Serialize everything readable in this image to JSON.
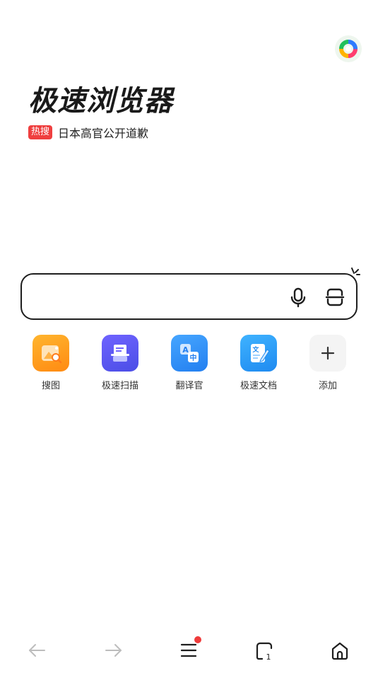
{
  "app": {
    "brand_title": "极速浏览器"
  },
  "hot_search": {
    "badge": "热搜",
    "text": "日本高官公开道歉"
  },
  "search": {
    "value": "",
    "placeholder": "",
    "mic_icon": "microphone-icon",
    "scan_icon": "scan-icon"
  },
  "shortcuts": [
    {
      "label": "搜图",
      "icon": "image-search-icon",
      "color": "#ff9a1f"
    },
    {
      "label": "极速扫描",
      "icon": "scanner-icon",
      "color": "#5b5cf0"
    },
    {
      "label": "翻译官",
      "icon": "translate-icon",
      "color": "#2f8cf5"
    },
    {
      "label": "极速文档",
      "icon": "document-icon",
      "color": "#2f9af5"
    },
    {
      "label": "添加",
      "icon": "plus-icon",
      "color": "#f4f4f4"
    }
  ],
  "bottom_nav": {
    "back": "back-arrow-icon",
    "forward": "forward-arrow-icon",
    "menu": "menu-icon",
    "tabs_count": "1",
    "home": "home-icon"
  },
  "colors": {
    "accent_red": "#ef3f3f",
    "text_dark": "#1a1a1a",
    "icon_gray": "#bdbdbd"
  }
}
